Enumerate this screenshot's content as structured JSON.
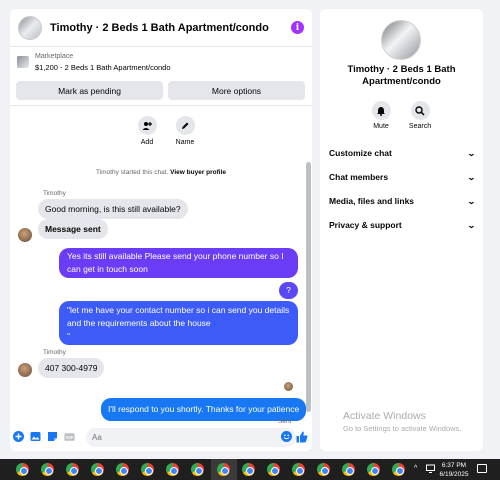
{
  "chat": {
    "title": "Timothy · 2 Beds 1 Bath Apartment/condo",
    "info_glyph": "i",
    "listing": {
      "category": "Marketplace",
      "price_line": "$1,200 - 2 Beds 1 Bath Apartment/condo"
    },
    "buttons": {
      "pending": "Mark as pending",
      "more": "More options"
    },
    "actions": [
      {
        "label": "Add",
        "icon": "add-person-icon"
      },
      {
        "label": "Name",
        "icon": "pencil-icon"
      }
    ],
    "started_text": "Timothy started this chat.",
    "started_link": "View buyer profile",
    "messages": {
      "sender1": "Timothy",
      "in1": "Good morning, is this still available?",
      "in2": "Message sent",
      "out1": "Yes its still available Please send your phone number so I can get in touch soon",
      "out2": "?",
      "out3": "\"let me have your contact number so i can send you details and the requirements about the house\n\"",
      "sender2": "Timothy",
      "in3": "407 300-4979",
      "out4": "I'll respond to you shortly. Thanks for your patience",
      "status": "Sent"
    },
    "composer": {
      "placeholder": "Aa"
    }
  },
  "info": {
    "title": "Timothy · 2 Beds 1 Bath Apartment/condo",
    "actions": [
      {
        "label": "Mute",
        "icon": "bell-icon"
      },
      {
        "label": "Search",
        "icon": "search-icon"
      }
    ],
    "sections": [
      "Customize chat",
      "Chat members",
      "Media, files and links",
      "Privacy & support"
    ],
    "watermark": {
      "title": "Activate Windows",
      "subtitle": "Go to Settings to activate Windows."
    }
  },
  "taskbar": {
    "time": "6:37 PM",
    "date": "6/19/2025",
    "tray_chevron": "^"
  },
  "colors": {
    "accent": "#1877f2",
    "purple": "#a033ff",
    "bubble_in": "#e4e6eb"
  }
}
